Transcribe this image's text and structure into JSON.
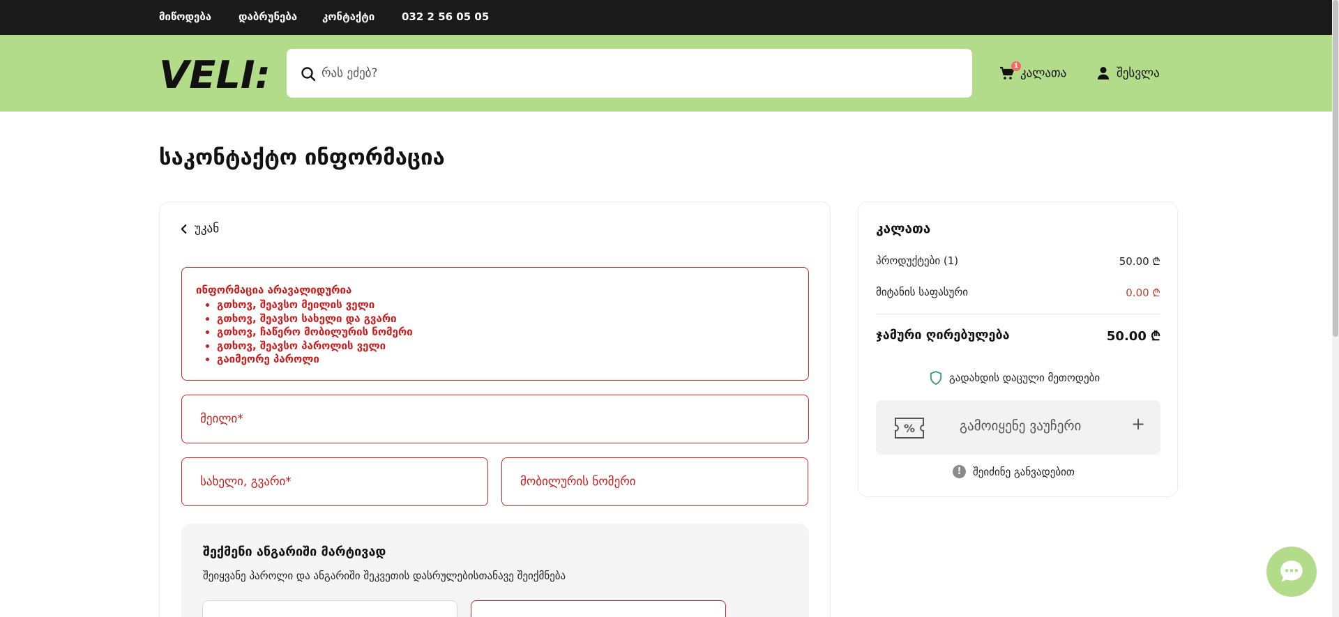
{
  "topbar": {
    "links": [
      "მიწოდება",
      "დაბრუნება",
      "კონტაქტი",
      "032 2 56 05 05"
    ]
  },
  "header": {
    "logo_text": "VELI:",
    "search_placeholder": "რას ეძებ?",
    "cart_label": "კალათა",
    "cart_count": "1",
    "login_label": "შესვლა"
  },
  "page": {
    "title": "საკონტაქტო ინფორმაცია",
    "back_label": "უკან"
  },
  "errors": {
    "title": "ინფორმაცია არავალიდურია",
    "items": [
      "გთხოვ, შეავსო მეილის ველი",
      "გთხოვ, შეავსო სახელი და გვარი",
      "გთხოვ, ჩაწერო მობილურის ნომერი",
      "გთხოვ, შეავსო პაროლის ველი",
      "გაიმეორე პაროლი"
    ]
  },
  "form": {
    "email_placeholder": "მეილი*",
    "name_placeholder": "სახელი, გვარი*",
    "phone_placeholder": "მობილურის ნომერი"
  },
  "account": {
    "title": "შექმენი ანგარიში მარტივად",
    "subtitle": "შეიყვანე პაროლი და ანგარიში შეკვეთის დასრულებისთანავე შეიქმნება"
  },
  "summary": {
    "title": "კალათა",
    "products_label": "პროდუქტები (1)",
    "products_value": "50.00 ₾",
    "shipping_label": "მიტანის საფასური",
    "shipping_value": "0.00 ₾",
    "total_label": "ჯამური ღირებულება",
    "total_value": "50.00 ₾",
    "secure_label": "გადახდის დაცული მეთოდები",
    "voucher_label": "გამოიყენე ვაუჩერი",
    "learn_label": "შეიძინე განვადებით"
  },
  "colors": {
    "header_bg": "#b3dc8a",
    "topbar_bg": "#1a1a1a",
    "error": "#c81e1e",
    "shipping_value": "#b0452b",
    "secure_icon": "#3aa17a"
  }
}
